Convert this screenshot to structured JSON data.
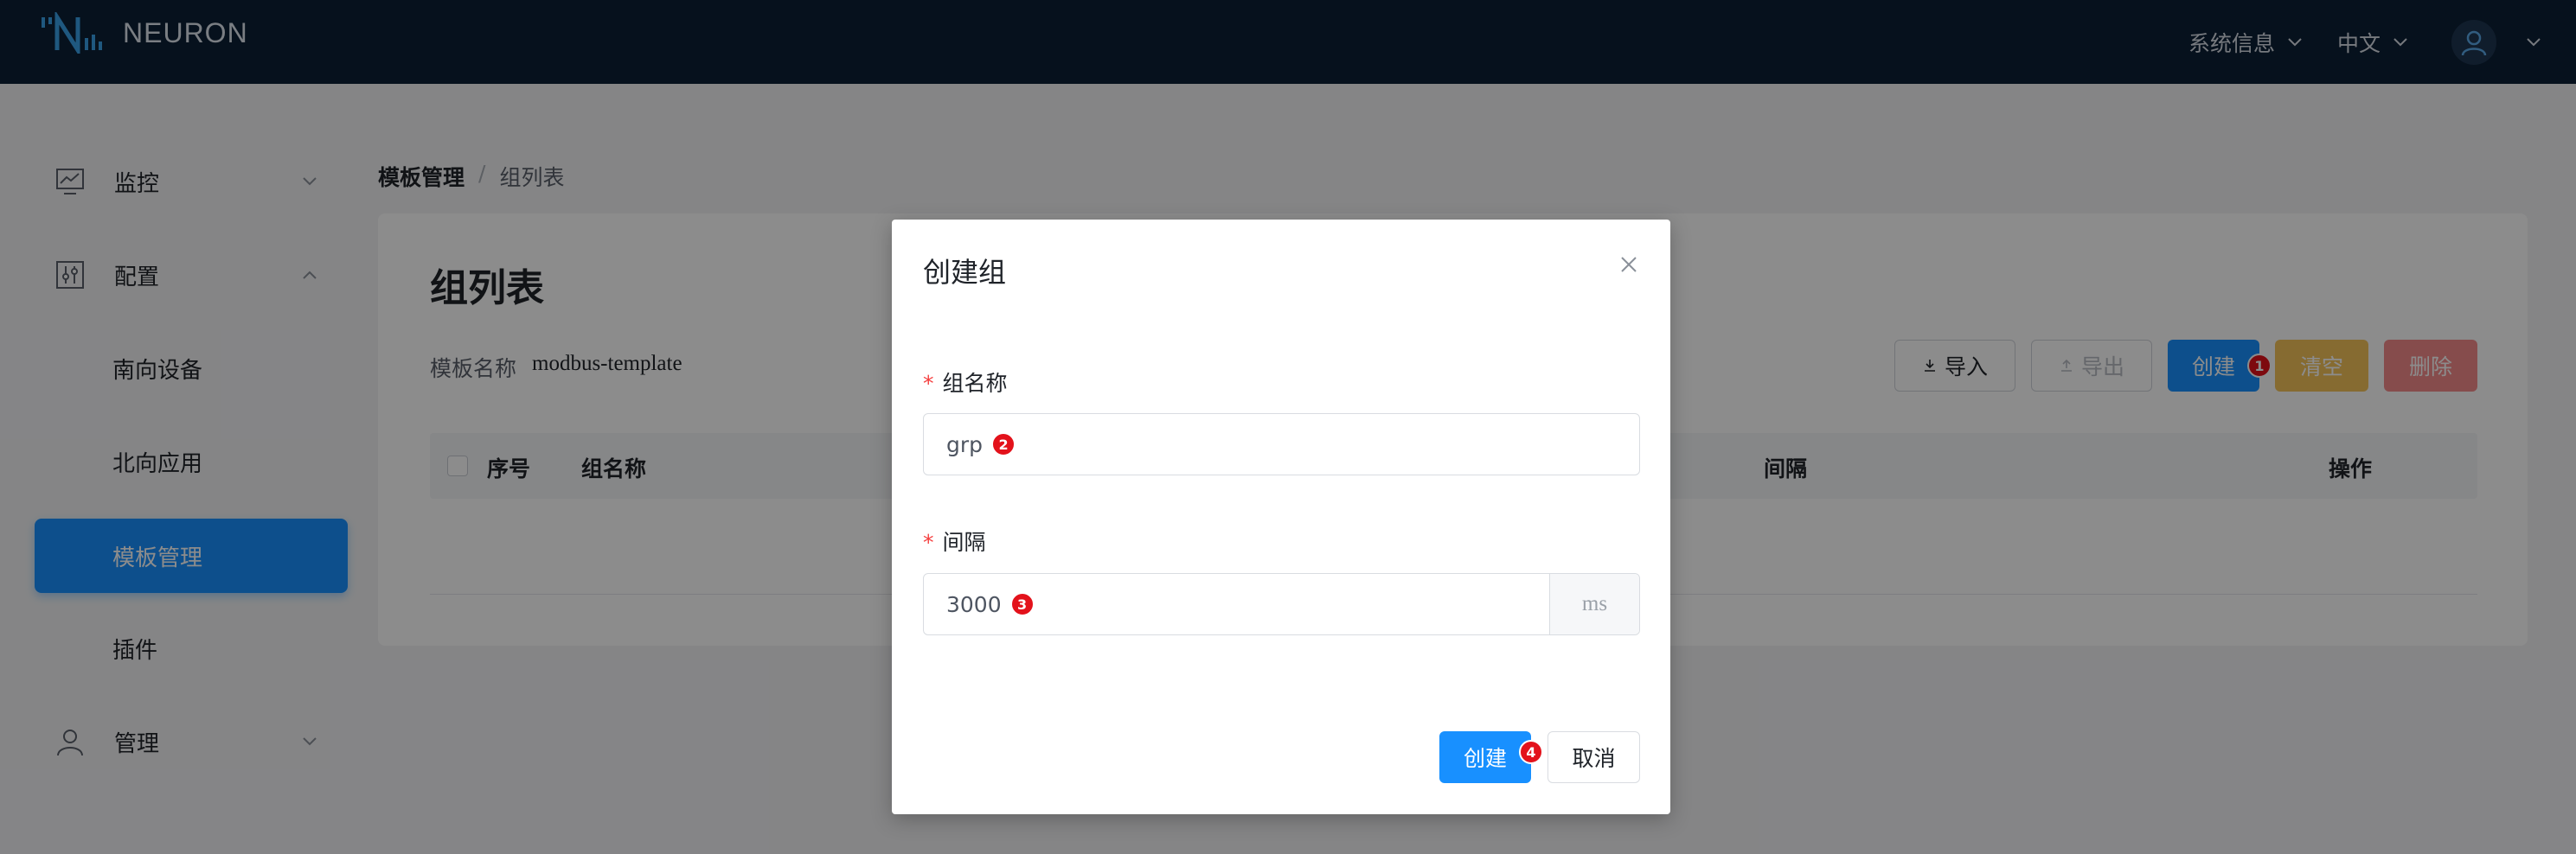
{
  "header": {
    "brand": "NEURON",
    "system_info": "系统信息",
    "language": "中文"
  },
  "sidebar": {
    "items": [
      {
        "label": "监控",
        "icon": "monitor-chart-icon"
      },
      {
        "label": "配置",
        "icon": "config-sliders-icon"
      },
      {
        "label": "南向设备"
      },
      {
        "label": "北向应用"
      },
      {
        "label": "模板管理",
        "active": true
      },
      {
        "label": "插件"
      },
      {
        "label": "管理",
        "icon": "user-icon"
      }
    ]
  },
  "breadcrumb": {
    "parent": "模板管理",
    "separator": "/",
    "current": "组列表"
  },
  "page": {
    "title": "组列表",
    "template_label": "模板名称",
    "template_value": "modbus-template",
    "toolbar": {
      "import_label": "导入",
      "export_label": "导出",
      "create_label": "创建",
      "create_badge": "1",
      "clear_label": "清空",
      "delete_label": "删除"
    },
    "table": {
      "columns": [
        "序号",
        "组名称",
        "间隔",
        "操作"
      ]
    }
  },
  "modal": {
    "title": "创建组",
    "group_name_label": "组名称",
    "group_name_value": "grp",
    "group_name_badge": "2",
    "interval_label": "间隔",
    "interval_value": "3000",
    "interval_badge": "3",
    "interval_unit": "ms",
    "required_mark": "*",
    "create_label": "创建",
    "create_badge": "4",
    "cancel_label": "取消"
  }
}
